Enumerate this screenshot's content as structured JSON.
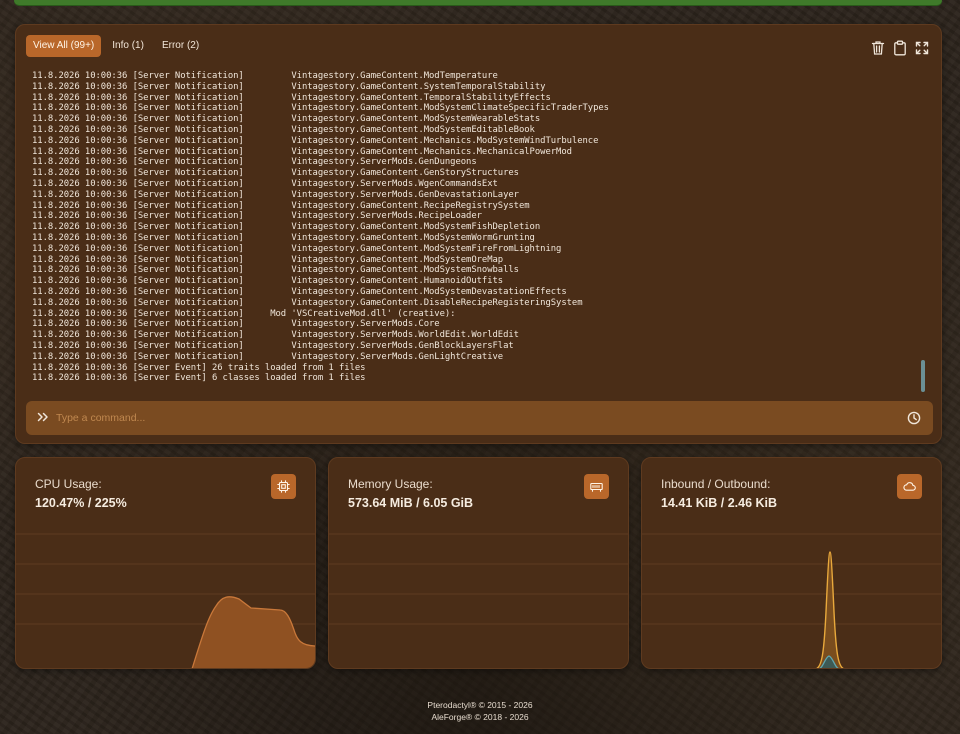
{
  "console": {
    "tabs": [
      {
        "label": "View All (99+)",
        "active": true
      },
      {
        "label": "Info (1)",
        "active": false
      },
      {
        "label": "Error (2)",
        "active": false
      }
    ],
    "actions": [
      "trash-icon",
      "clipboard-icon",
      "expand-icon"
    ],
    "log_lines": [
      "11.8.2026 10:00:36 [Server Notification]         Vintagestory.GameContent.ModTemperature",
      "11.8.2026 10:00:36 [Server Notification]         Vintagestory.GameContent.SystemTemporalStability",
      "11.8.2026 10:00:36 [Server Notification]         Vintagestory.GameContent.TemporalStabilityEffects",
      "11.8.2026 10:00:36 [Server Notification]         Vintagestory.GameContent.ModSystemClimateSpecificTraderTypes",
      "11.8.2026 10:00:36 [Server Notification]         Vintagestory.GameContent.ModSystemWearableStats",
      "11.8.2026 10:00:36 [Server Notification]         Vintagestory.GameContent.ModSystemEditableBook",
      "11.8.2026 10:00:36 [Server Notification]         Vintagestory.GameContent.Mechanics.ModSystemWindTurbulence",
      "11.8.2026 10:00:36 [Server Notification]         Vintagestory.GameContent.Mechanics.MechanicalPowerMod",
      "11.8.2026 10:00:36 [Server Notification]         Vintagestory.ServerMods.GenDungeons",
      "11.8.2026 10:00:36 [Server Notification]         Vintagestory.GameContent.GenStoryStructures",
      "11.8.2026 10:00:36 [Server Notification]         Vintagestory.ServerMods.WgenCommandsExt",
      "11.8.2026 10:00:36 [Server Notification]         Vintagestory.ServerMods.GenDevastationLayer",
      "11.8.2026 10:00:36 [Server Notification]         Vintagestory.GameContent.RecipeRegistrySystem",
      "11.8.2026 10:00:36 [Server Notification]         Vintagestory.ServerMods.RecipeLoader",
      "11.8.2026 10:00:36 [Server Notification]         Vintagestory.GameContent.ModSystemFishDepletion",
      "11.8.2026 10:00:36 [Server Notification]         Vintagestory.GameContent.ModSystemWormGrunting",
      "11.8.2026 10:00:36 [Server Notification]         Vintagestory.GameContent.ModSystemFireFromLightning",
      "11.8.2026 10:00:36 [Server Notification]         Vintagestory.GameContent.ModSystemOreMap",
      "11.8.2026 10:00:36 [Server Notification]         Vintagestory.GameContent.ModSystemSnowballs",
      "11.8.2026 10:00:36 [Server Notification]         Vintagestory.GameContent.HumanoidOutfits",
      "11.8.2026 10:00:36 [Server Notification]         Vintagestory.GameContent.ModSystemDevastationEffects",
      "11.8.2026 10:00:36 [Server Notification]         Vintagestory.GameContent.DisableRecipeRegisteringSystem",
      "11.8.2026 10:00:36 [Server Notification]     Mod 'VSCreativeMod.dll' (creative):",
      "11.8.2026 10:00:36 [Server Notification]         Vintagestory.ServerMods.Core",
      "11.8.2026 10:00:36 [Server Notification]         Vintagestory.ServerMods.WorldEdit.WorldEdit",
      "11.8.2026 10:00:36 [Server Notification]         Vintagestory.ServerMods.GenBlockLayersFlat",
      "11.8.2026 10:00:36 [Server Notification]         Vintagestory.ServerMods.GenLightCreative",
      "11.8.2026 10:00:36 [Server Event] 26 traits loaded from 1 files",
      "11.8.2026 10:00:36 [Server Event] 6 classes loaded from 1 files"
    ],
    "command_placeholder": "Type a command...",
    "prompt_icon": "chevrons-right-icon",
    "history_icon": "clock-icon"
  },
  "stats": {
    "cpu": {
      "title": "CPU Usage:",
      "value": "120.47% / 225%",
      "icon": "cpu-icon"
    },
    "memory": {
      "title": "Memory Usage:",
      "value": "573.64 MiB / 6.05 GiB",
      "icon": "memory-icon"
    },
    "network": {
      "title": "Inbound / Outbound:",
      "value": "14.41 KiB / 2.46 KiB",
      "icon": "cloud-icon"
    }
  },
  "colors": {
    "accent": "#b9672a",
    "panel": "#4a2d17",
    "command_bar": "#7a4b21",
    "cpu_line": "#c9783a",
    "net_outbound": "#e9a93c",
    "net_inbound": "#5fa7b0"
  },
  "footer": {
    "line1": "Pterodactyl® © 2015 - 2026",
    "line2": "AleForge® © 2018 - 2026"
  }
}
